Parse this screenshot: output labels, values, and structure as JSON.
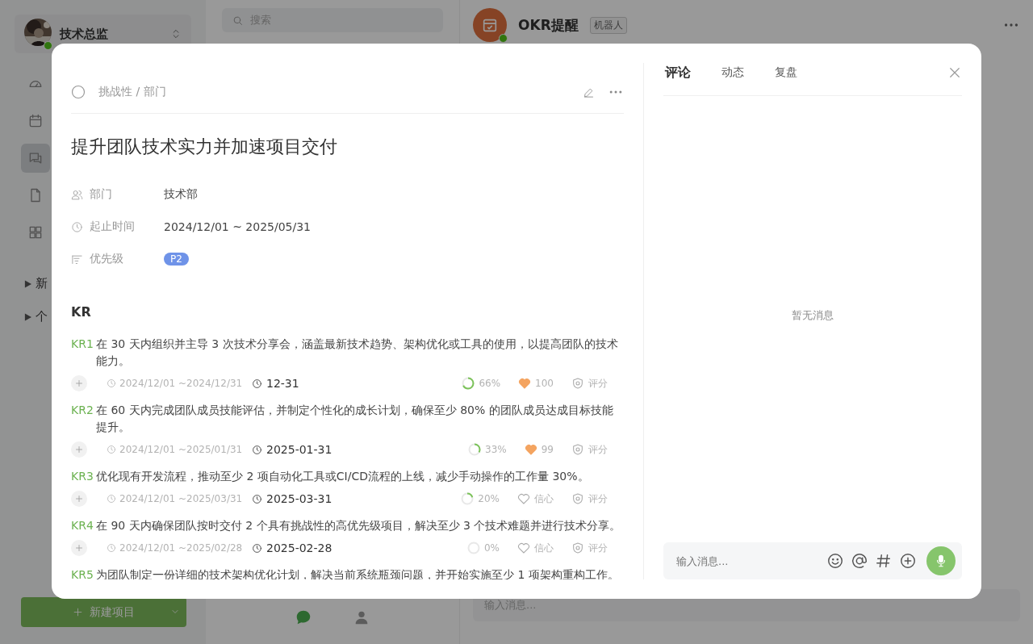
{
  "sidebar": {
    "user": {
      "name": "技术总监",
      "online": true
    },
    "nav": [
      {
        "kind": "gauge",
        "selected": false
      },
      {
        "kind": "calendar",
        "selected": false
      },
      {
        "kind": "chat",
        "selected": true
      },
      {
        "kind": "document",
        "selected": false
      },
      {
        "kind": "apps",
        "selected": false
      }
    ],
    "tree": [
      {
        "label": "新",
        "expanded": false
      },
      {
        "label": "个",
        "expanded": false
      }
    ],
    "new_button": "新建项目"
  },
  "search": {
    "placeholder": "搜索"
  },
  "bottom_nav": [
    {
      "kind": "chat",
      "selected": true
    },
    {
      "kind": "contacts",
      "selected": false
    }
  ],
  "chat": {
    "title": "OKR提醒",
    "tag": "机器人",
    "online": true,
    "input_placeholder": "输入消息..."
  },
  "modal": {
    "breadcrumb": "挑战性 / 部门",
    "title": "提升团队技术实力并加速项目交付",
    "fields": [
      {
        "kind": "department",
        "label": "部门",
        "value": "技术部"
      },
      {
        "kind": "time",
        "label": "起止时间",
        "value": "2024/12/01 ~ 2025/05/31"
      },
      {
        "kind": "priority",
        "label": "优先级",
        "badge": "P2"
      }
    ],
    "kr_heading": "KR",
    "krs": [
      {
        "tag": "KR1",
        "text": "在 30 天内组织并主导 3 次技术分享会，涵盖最新技术趋势、架构优化或工具的使用，以提高团队的技术能力。",
        "range": "2024/12/01 ~2024/12/31",
        "deadline": "12-31",
        "percent": "66%",
        "liked": true,
        "likes": "100",
        "score": "评分"
      },
      {
        "tag": "KR2",
        "text": "在 60 天内完成团队成员技能评估，并制定个性化的成长计划，确保至少 80% 的团队成员达成目标技能提升。",
        "range": "2024/12/01 ~2025/01/31",
        "deadline": "2025-01-31",
        "percent": "33%",
        "liked": true,
        "likes": "99",
        "score": "评分"
      },
      {
        "tag": "KR3",
        "text": "优化现有开发流程，推动至少 2 项自动化工具或CI/CD流程的上线，减少手动操作的工作量 30%。",
        "range": "2024/12/01 ~2025/03/31",
        "deadline": "2025-03-31",
        "percent": "20%",
        "liked": false,
        "likes": "信心",
        "score": "评分"
      },
      {
        "tag": "KR4",
        "text": "在 90 天内确保团队按时交付 2 个具有挑战性的高优先级项目，解决至少 3 个技术难题并进行技术分享。",
        "range": "2024/12/01 ~2025/02/28",
        "deadline": "2025-02-28",
        "percent": "0%",
        "liked": false,
        "likes": "信心",
        "score": "评分"
      },
      {
        "tag": "KR5",
        "text": "为团队制定一份详细的技术架构优化计划，解决当前系统瓶颈问题，并开始实施至少 1 项架构重构工作。"
      }
    ],
    "tabs": [
      {
        "label": "评论",
        "selected": true
      },
      {
        "label": "动态",
        "selected": false
      },
      {
        "label": "复盘",
        "selected": false
      }
    ],
    "empty": "暂无消息",
    "input_placeholder": "输入消息..."
  }
}
